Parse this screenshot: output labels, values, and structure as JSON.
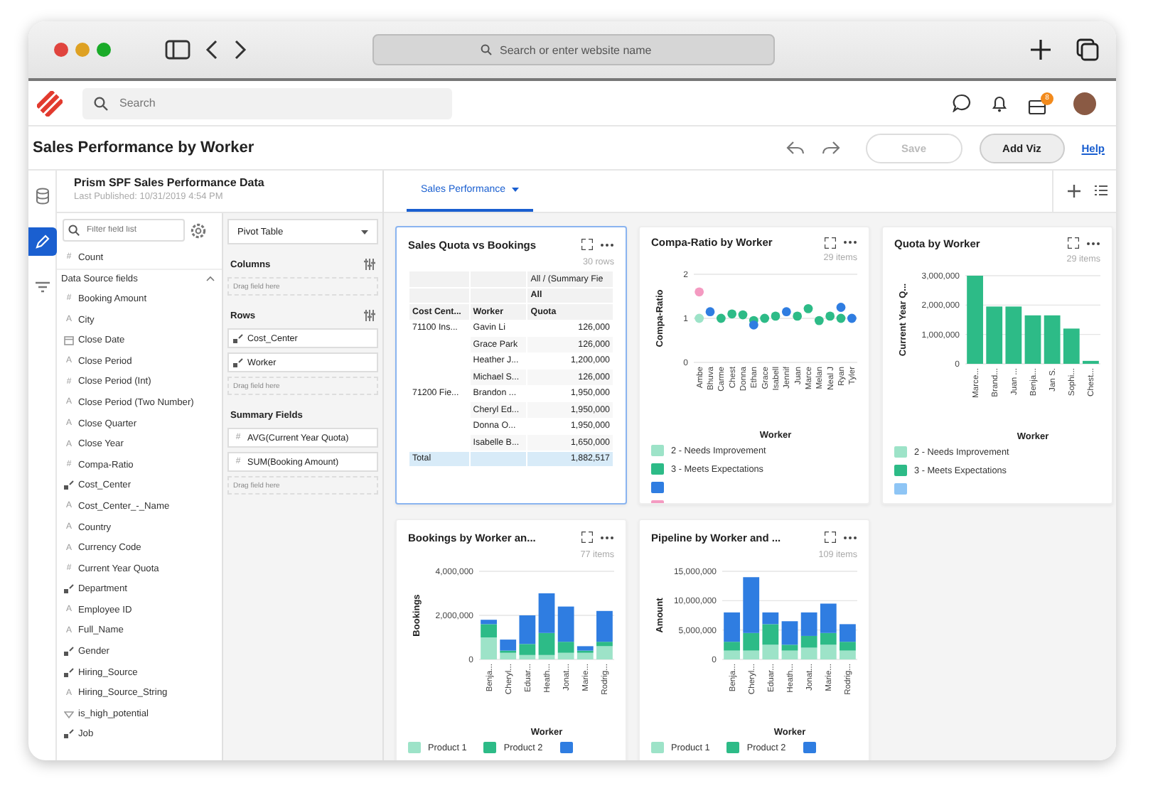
{
  "browser": {
    "address_placeholder": "Search or enter website name"
  },
  "app_header": {
    "search_placeholder": "Search",
    "notification_badge": "8"
  },
  "title_bar": {
    "title": "Sales Performance by Worker",
    "save": {
      "label": "Save",
      "disabled": true
    },
    "add_viz": "Add Viz",
    "help": "Help"
  },
  "rail": [
    {
      "kind": "database",
      "selected": false
    },
    {
      "kind": "pencil",
      "selected": true
    },
    {
      "kind": "filter",
      "selected": false
    }
  ],
  "data_panel": {
    "title": "Prism SPF Sales Performance Data",
    "subtitle": "Last Published: 10/31/2019 4:54 PM",
    "filter_placeholder": "Filter field list",
    "top_fields": [
      {
        "kind": "number",
        "glyph": "#",
        "name": "Count"
      }
    ],
    "section": {
      "title": "Data Source fields",
      "expanded": true,
      "fields": [
        {
          "kind": "number",
          "glyph": "#",
          "name": "Booking Amount"
        },
        {
          "kind": "text",
          "glyph": "A",
          "name": "City"
        },
        {
          "kind": "date",
          "name": "Close Date"
        },
        {
          "kind": "text",
          "glyph": "A",
          "name": "Close Period"
        },
        {
          "kind": "number",
          "glyph": "#",
          "name": "Close Period (Int)"
        },
        {
          "kind": "text",
          "glyph": "A",
          "name": "Close Period (Two Number)"
        },
        {
          "kind": "text",
          "glyph": "A",
          "name": "Close Quarter"
        },
        {
          "kind": "text",
          "glyph": "A",
          "name": "Close Year"
        },
        {
          "kind": "number",
          "glyph": "#",
          "name": "Compa-Ratio"
        },
        {
          "kind": "dimension",
          "name": "Cost_Center"
        },
        {
          "kind": "text",
          "glyph": "A",
          "name": "Cost_Center_-_Name"
        },
        {
          "kind": "text",
          "glyph": "A",
          "name": "Country"
        },
        {
          "kind": "text",
          "glyph": "A",
          "name": "Currency Code"
        },
        {
          "kind": "number",
          "glyph": "#",
          "name": "Current Year Quota"
        },
        {
          "kind": "dimension",
          "name": "Department"
        },
        {
          "kind": "text",
          "glyph": "A",
          "name": "Employee ID"
        },
        {
          "kind": "text",
          "glyph": "A",
          "name": "Full_Name"
        },
        {
          "kind": "dimension",
          "name": "Gender"
        },
        {
          "kind": "dimension",
          "name": "Hiring_Source"
        },
        {
          "kind": "text",
          "glyph": "A",
          "name": "Hiring_Source_String"
        },
        {
          "kind": "boolean",
          "name": "is_high_potential"
        },
        {
          "kind": "dimension",
          "name": "Job"
        }
      ]
    }
  },
  "config": {
    "viz_type": "Pivot Table",
    "sections": [
      {
        "title": "Columns",
        "settings": true,
        "drop_hint": "Drag field here"
      },
      {
        "title": "Rows",
        "settings": true,
        "chips": [
          {
            "kind": "dimension",
            "name": "Cost_Center"
          },
          {
            "kind": "dimension",
            "name": "Worker"
          }
        ],
        "drop_hint": "Drag field here"
      },
      {
        "title": "Summary Fields",
        "settings": false,
        "chips": [
          {
            "kind": "number",
            "glyph": "#",
            "name": "AVG(Current Year Quota)"
          },
          {
            "kind": "number",
            "glyph": "#",
            "name": "SUM(Booking Amount)"
          }
        ],
        "drop_hint": "Drag field here"
      }
    ]
  },
  "tabs": [
    {
      "label": "Sales Performance",
      "selected": true
    }
  ],
  "cards": [
    {
      "kind": "pivot",
      "title": "Sales Quota vs Bookings",
      "selected": true,
      "count": "30 rows",
      "column_group": "All / (Summary Fie",
      "column_subgroup": "All",
      "columns": [
        "Cost Cent...",
        "Worker",
        "Quota"
      ],
      "rows": [
        {
          "group": "71100 Ins...",
          "worker": "Gavin Li",
          "quota": "126,000"
        },
        {
          "worker": "Grace Park",
          "quota": "126,000"
        },
        {
          "worker": "Heather J...",
          "quota": "1,200,000"
        },
        {
          "worker": "Michael S...",
          "quota": "126,000"
        },
        {
          "group": "71200 Fie...",
          "worker": "Brandon ...",
          "quota": "1,950,000"
        },
        {
          "worker": "Cheryl Ed...",
          "quota": "1,950,000"
        },
        {
          "worker": "Donna O...",
          "quota": "1,950,000"
        },
        {
          "worker": "Isabelle B...",
          "quota": "1,650,000"
        }
      ],
      "total": {
        "label": "Total",
        "quota": "1,882,517"
      }
    },
    {
      "kind": "chart",
      "selected": false,
      "count": "29 items",
      "chart_data": {
        "type": "scatter",
        "title": "Compa-Ratio by Worker",
        "xlabel": "Worker",
        "ylabel": "Compa-Ratio",
        "categories": [
          "Ambe",
          "Bhuva",
          "Carme",
          "Chest",
          "Donna",
          "Ethan",
          "Grace",
          "Isabell",
          "Jennif",
          "Juan",
          "Marce",
          "Melan",
          "Neal J",
          "Ryan",
          "Tyler"
        ],
        "ylim": [
          0,
          2
        ],
        "grid": true,
        "yticks": [
          0,
          1,
          2
        ],
        "series": [
          {
            "name": "2 - Needs Improvement",
            "color": "#9de3c8",
            "values": [
              1.0,
              null,
              null,
              null,
              null,
              null,
              null,
              null,
              null,
              null,
              null,
              null,
              null,
              null,
              null
            ]
          },
          {
            "name": "3 - Meets Expectations",
            "color": "#2dbb87",
            "values": [
              null,
              null,
              1.0,
              1.1,
              1.08,
              0.95,
              1.0,
              1.05,
              null,
              1.05,
              1.22,
              0.95,
              1.05,
              1.0,
              null
            ]
          },
          {
            "color": "#2f7de1",
            "values": [
              null,
              1.15,
              null,
              null,
              null,
              0.85,
              null,
              null,
              1.15,
              null,
              null,
              null,
              null,
              1.25,
              1.0
            ]
          },
          {
            "color": "#f49ac1",
            "values": [
              1.6,
              null,
              null,
              null,
              null,
              null,
              null,
              null,
              null,
              null,
              null,
              null,
              null,
              null,
              null
            ]
          }
        ]
      }
    },
    {
      "kind": "chart",
      "selected": false,
      "count": "29 items",
      "chart_data": {
        "type": "bar",
        "stacked": true,
        "title": "Quota by Worker",
        "xlabel": "Worker",
        "ylabel": "Current Year Q...",
        "categories": [
          "Marce...",
          "Brand...",
          "Juan ...",
          "Benja...",
          "Jan S.",
          "Sophi...",
          "Chest..."
        ],
        "ylim": [
          0,
          3000000
        ],
        "grid": true,
        "yticks": [
          0,
          {
            "value": 1000000,
            "label": "1,000,000"
          },
          {
            "value": 2000000,
            "label": "2,000,000"
          },
          {
            "value": 3000000,
            "label": "3,000,000"
          }
        ],
        "series": [
          {
            "name": "2 - Needs Improvement",
            "color": "#9de3c8",
            "values": [
              0,
              0,
              0,
              0,
              0,
              0,
              0
            ]
          },
          {
            "name": "3 - Meets Expectations",
            "color": "#2dbb87",
            "values": [
              3000000,
              1950000,
              1950000,
              1650000,
              1650000,
              1200000,
              100000
            ]
          },
          {
            "color": "#8ec5f5",
            "values": [
              0,
              0,
              0,
              0,
              0,
              0,
              0
            ]
          }
        ]
      }
    },
    {
      "kind": "chart",
      "selected": false,
      "count": "77 items",
      "chart_data": {
        "type": "bar",
        "stacked": true,
        "title": "Bookings by Worker an...",
        "xlabel": "Worker",
        "ylabel": "Bookings",
        "categories": [
          "Benja...",
          "Cheryl...",
          "Eduar...",
          "Heath...",
          "Jonat...",
          "Marie...",
          "Rodrig..."
        ],
        "ylim": [
          0,
          4000000
        ],
        "grid": true,
        "yticks": [
          0,
          {
            "value": 2000000,
            "label": "2,000,000"
          },
          {
            "value": 4000000,
            "label": "4,000,000"
          }
        ],
        "series": [
          {
            "name": "Product 1",
            "color": "#9de3c8",
            "values": [
              1000000,
              300000,
              200000,
              200000,
              300000,
              300000,
              600000
            ]
          },
          {
            "name": "Product 2",
            "color": "#2dbb87",
            "values": [
              600000,
              100000,
              500000,
              1000000,
              500000,
              100000,
              200000
            ]
          },
          {
            "color": "#2f7de1",
            "values": [
              200000,
              500000,
              1300000,
              1800000,
              1600000,
              200000,
              1400000
            ]
          }
        ]
      }
    },
    {
      "kind": "chart",
      "selected": false,
      "count": "109 items",
      "chart_data": {
        "type": "bar",
        "stacked": true,
        "title": "Pipeline by Worker and ...",
        "xlabel": "Worker",
        "ylabel": "Amount",
        "categories": [
          "Benja...",
          "Cheryl...",
          "Eduar...",
          "Heath...",
          "Jonat...",
          "Marie...",
          "Rodrig..."
        ],
        "ylim": [
          0,
          15000000
        ],
        "grid": true,
        "yticks": [
          0,
          {
            "value": 5000000,
            "label": "5,000,000"
          },
          {
            "value": 10000000,
            "label": "10,000,000"
          },
          {
            "value": 15000000,
            "label": "15,000,000"
          }
        ],
        "series": [
          {
            "name": "Product 1",
            "color": "#9de3c8",
            "values": [
              1500000,
              1500000,
              2500000,
              1500000,
              2000000,
              2500000,
              1500000
            ]
          },
          {
            "name": "Product 2",
            "color": "#2dbb87",
            "values": [
              1500000,
              3000000,
              3500000,
              1000000,
              2000000,
              2000000,
              1500000
            ]
          },
          {
            "color": "#2f7de1",
            "values": [
              5000000,
              9500000,
              2000000,
              4000000,
              4000000,
              5000000,
              3000000
            ]
          }
        ]
      }
    }
  ]
}
